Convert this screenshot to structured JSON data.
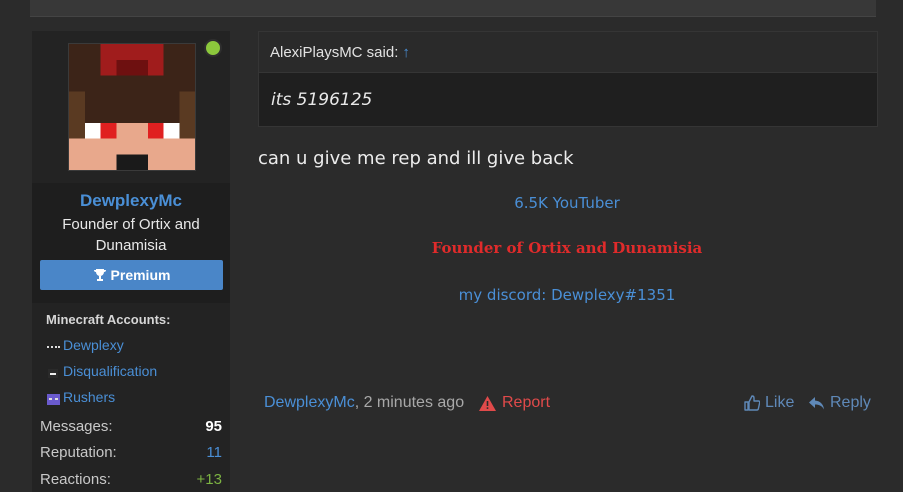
{
  "post": {
    "author": {
      "username": "DewplexyMc",
      "title": "Founder of Ortix and Dunamisia",
      "badge": "Premium",
      "online": true,
      "avatar_icon": "minecraft-skin-avatar"
    },
    "accounts": {
      "heading": "Minecraft Accounts:",
      "items": [
        {
          "name": "Dewplexy",
          "icon": "skin-head-icon"
        },
        {
          "name": "Disqualification",
          "icon": "skin-head-icon"
        },
        {
          "name": "Rushers",
          "icon": "skin-head-icon"
        }
      ]
    },
    "stats": [
      {
        "label": "Messages:",
        "value": "95",
        "color": "#ffffff"
      },
      {
        "label": "Reputation:",
        "value": "11",
        "color": "#4a8fd6"
      },
      {
        "label": "Reactions:",
        "value": "+13",
        "color": "#7cb342"
      }
    ],
    "quote": {
      "author_said": "AlexiPlaysMC said:",
      "arrow": "↑",
      "text": "its 5196125"
    },
    "message": "can u give me rep and ill give back",
    "signature": {
      "line1": "6.5K YouTuber",
      "line2": "Founder of Ortix and Dunamisia",
      "line3": "my discord: Dewplexy#1351"
    },
    "footer": {
      "author": "DewplexyMc",
      "time": ", 2 minutes ago",
      "report": "Report",
      "like": "Like",
      "reply": "Reply"
    }
  },
  "colors": {
    "link": "#4a8fd6",
    "premium": "#4a86c8",
    "report": "#e04a4a",
    "online": "#8cc83c"
  }
}
